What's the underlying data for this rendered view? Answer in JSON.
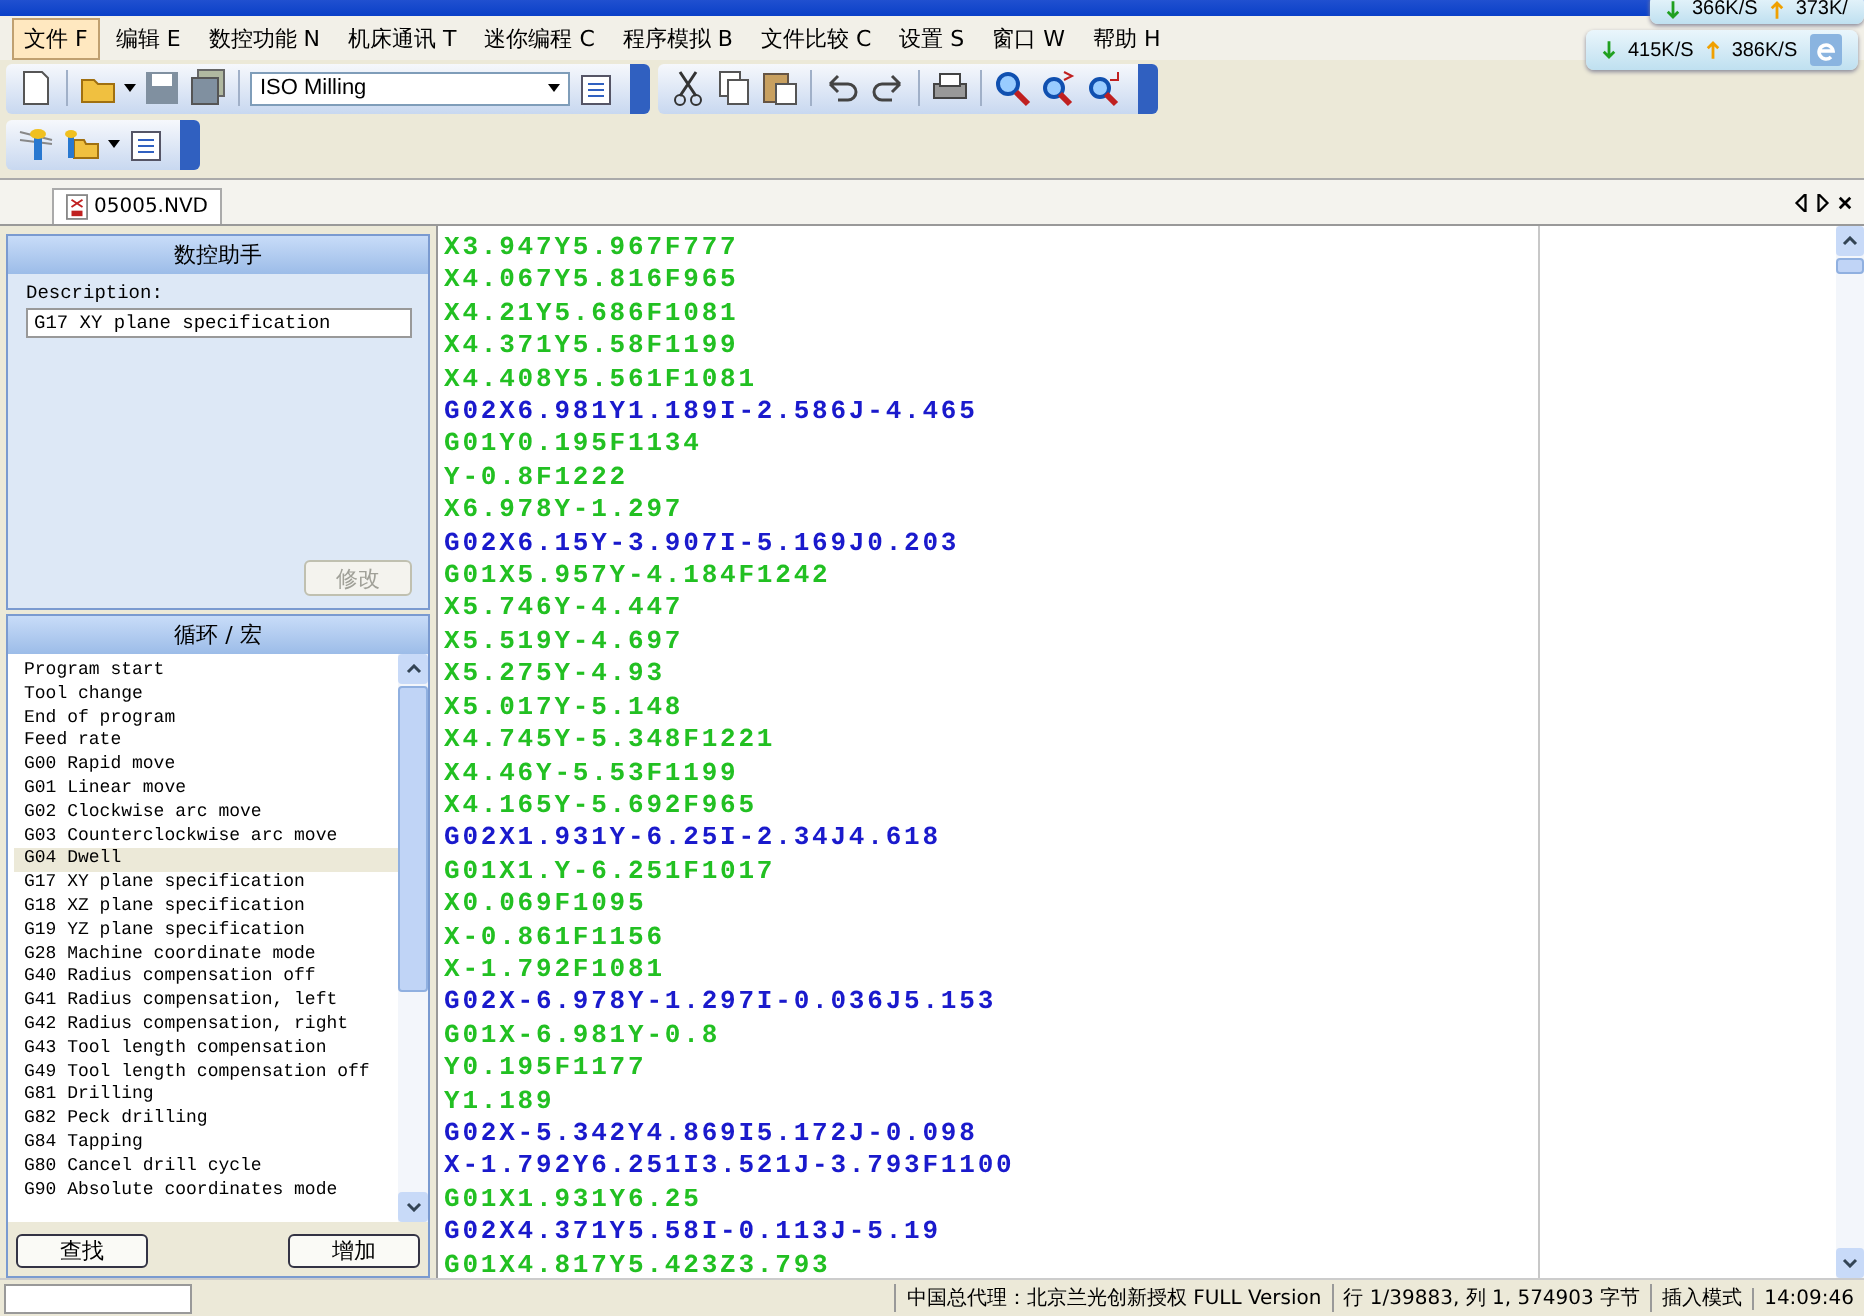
{
  "menu": [
    {
      "label": "文件 F",
      "selected": true
    },
    {
      "label": "编辑 E",
      "selected": false
    },
    {
      "label": "数控功能 N",
      "selected": false
    },
    {
      "label": "机床通讯 T",
      "selected": false
    },
    {
      "label": "迷你编程 C",
      "selected": false
    },
    {
      "label": "程序模拟 B",
      "selected": false
    },
    {
      "label": "文件比较 C",
      "selected": false
    },
    {
      "label": "设置 S",
      "selected": false
    },
    {
      "label": "窗口 W",
      "selected": false
    },
    {
      "label": "帮助 H",
      "selected": false
    }
  ],
  "net_widgets": [
    {
      "down": "366K/S",
      "up": "373K/"
    },
    {
      "down": "415K/S",
      "up": "386K/S"
    }
  ],
  "toolbar": {
    "machine_type": "ISO Milling"
  },
  "tabs": [
    {
      "label": "05005.NVD",
      "selected": true
    }
  ],
  "assistant": {
    "title": "数控助手",
    "description_label": "Description:",
    "description": "G17 XY plane specification",
    "modify_button": "修改",
    "modify_disabled": true
  },
  "cycles": {
    "title": "循环 / 宏",
    "items": [
      {
        "label": "Program start",
        "selected": false
      },
      {
        "label": "Tool change",
        "selected": false
      },
      {
        "label": "End of program",
        "selected": false
      },
      {
        "label": "Feed rate",
        "selected": false
      },
      {
        "label": "G00 Rapid move",
        "selected": false
      },
      {
        "label": "G01 Linear move",
        "selected": false
      },
      {
        "label": "G02 Clockwise arc move",
        "selected": false
      },
      {
        "label": "G03 Counterclockwise arc move",
        "selected": false
      },
      {
        "label": "G04 Dwell",
        "selected": true
      },
      {
        "label": "G17 XY plane specification",
        "selected": false
      },
      {
        "label": "G18 XZ plane specification",
        "selected": false
      },
      {
        "label": "G19 YZ plane specification",
        "selected": false
      },
      {
        "label": "G28 Machine coordinate mode",
        "selected": false
      },
      {
        "label": "G40 Radius compensation off",
        "selected": false
      },
      {
        "label": "G41 Radius compensation, left",
        "selected": false
      },
      {
        "label": "G42 Radius compensation, right",
        "selected": false
      },
      {
        "label": "G43 Tool length compensation",
        "selected": false
      },
      {
        "label": "G49 Tool length compensation off",
        "selected": false
      },
      {
        "label": "G81 Drilling",
        "selected": false
      },
      {
        "label": "G82 Peck drilling",
        "selected": false
      },
      {
        "label": "G84 Tapping",
        "selected": false
      },
      {
        "label": "G80 Cancel drill cycle",
        "selected": false
      },
      {
        "label": "G90 Absolute coordinates mode",
        "selected": false
      }
    ],
    "buttons": [
      "查找",
      "增加"
    ]
  },
  "code_lines": [
    {
      "text": "X3.947Y5.967F777",
      "kind": "linear"
    },
    {
      "text": "X4.067Y5.816F965",
      "kind": "linear"
    },
    {
      "text": "X4.21Y5.686F1081",
      "kind": "linear"
    },
    {
      "text": "X4.371Y5.58F1199",
      "kind": "linear"
    },
    {
      "text": "X4.408Y5.561F1081",
      "kind": "linear"
    },
    {
      "text": "G02X6.981Y1.189I-2.586J-4.465",
      "kind": "arc"
    },
    {
      "text": "G01Y0.195F1134",
      "kind": "linear"
    },
    {
      "text": "Y-0.8F1222",
      "kind": "linear"
    },
    {
      "text": "X6.978Y-1.297",
      "kind": "linear"
    },
    {
      "text": "G02X6.15Y-3.907I-5.169J0.203",
      "kind": "arc"
    },
    {
      "text": "G01X5.957Y-4.184F1242",
      "kind": "linear"
    },
    {
      "text": "X5.746Y-4.447",
      "kind": "linear"
    },
    {
      "text": "X5.519Y-4.697",
      "kind": "linear"
    },
    {
      "text": "X5.275Y-4.93",
      "kind": "linear"
    },
    {
      "text": "X5.017Y-5.148",
      "kind": "linear"
    },
    {
      "text": "X4.745Y-5.348F1221",
      "kind": "linear"
    },
    {
      "text": "X4.46Y-5.53F1199",
      "kind": "linear"
    },
    {
      "text": "X4.165Y-5.692F965",
      "kind": "linear"
    },
    {
      "text": "G02X1.931Y-6.25I-2.34J4.618",
      "kind": "arc"
    },
    {
      "text": "G01X1.Y-6.251F1017",
      "kind": "linear"
    },
    {
      "text": "X0.069F1095",
      "kind": "linear"
    },
    {
      "text": "X-0.861F1156",
      "kind": "linear"
    },
    {
      "text": "X-1.792F1081",
      "kind": "linear"
    },
    {
      "text": "G02X-6.978Y-1.297I-0.036J5.153",
      "kind": "arc"
    },
    {
      "text": "G01X-6.981Y-0.8",
      "kind": "linear"
    },
    {
      "text": "Y0.195F1177",
      "kind": "linear"
    },
    {
      "text": "Y1.189",
      "kind": "linear"
    },
    {
      "text": "G02X-5.342Y4.869I5.172J-0.098",
      "kind": "arc"
    },
    {
      "text": "X-1.792Y6.251I3.521J-3.793F1100",
      "kind": "arc"
    },
    {
      "text": "G01X1.931Y6.25",
      "kind": "linear"
    },
    {
      "text": "G02X4.371Y5.58I-0.113J-5.19",
      "kind": "arc"
    },
    {
      "text": "G01X4.817Y5.423Z3.793",
      "kind": "linear"
    }
  ],
  "status_bar": {
    "agent": "中国总代理：北京兰光创新授权 FULL Version",
    "position": "行 1/39883, 列 1, 574903 字节",
    "mode": "插入模式",
    "time": "14:09:46"
  }
}
